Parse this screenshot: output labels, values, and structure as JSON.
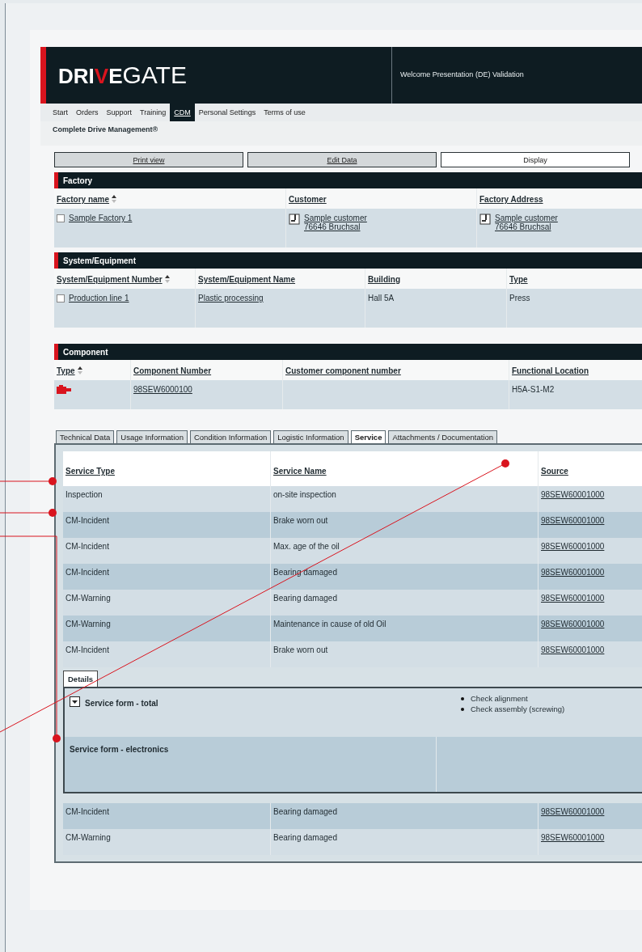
{
  "header": {
    "logo": {
      "lead": "DRI",
      "accent": "V",
      "tail": "E",
      "word": "GATE"
    },
    "welcome": "Welcome Presentation (DE) Validation"
  },
  "nav": [
    {
      "label": "Start",
      "selected": false
    },
    {
      "label": "Orders",
      "selected": false
    },
    {
      "label": "Support",
      "selected": false
    },
    {
      "label": "Training",
      "selected": false
    },
    {
      "label": "CDM",
      "selected": true
    },
    {
      "label": "Personal Settings",
      "selected": false
    },
    {
      "label": "Terms of use",
      "selected": false
    }
  ],
  "subtitle": "Complete Drive Management®",
  "actions": [
    {
      "label": "Print view",
      "selected": false
    },
    {
      "label": "Edit Data",
      "selected": false
    },
    {
      "label": "Display",
      "selected": true
    }
  ],
  "sections": [
    {
      "title": "Factory",
      "columns": [
        {
          "label": "Factory name",
          "sorted": true
        },
        {
          "label": "Customer",
          "sorted": false
        },
        {
          "label": "Factory Address",
          "sorted": false
        }
      ],
      "rows": [
        [
          {
            "kind": "checkbox-link",
            "checked": false,
            "lines": [
              "Sample Factory 1"
            ]
          },
          {
            "kind": "contact-link",
            "lines": [
              "Sample customer",
              "76646 Bruchsal"
            ]
          },
          {
            "kind": "contact-link",
            "lines": [
              "Sample customer",
              "76646 Bruchsal"
            ]
          }
        ]
      ]
    },
    {
      "title": "System/Equipment",
      "columns": [
        {
          "label": "System/Equipment Number",
          "sorted": true
        },
        {
          "label": "System/Equipment Name",
          "sorted": false
        },
        {
          "label": "Building",
          "sorted": false
        },
        {
          "label": "Type",
          "sorted": false
        }
      ],
      "rows": [
        [
          {
            "kind": "checkbox-link",
            "checked": false,
            "lines": [
              "Production line 1"
            ]
          },
          {
            "kind": "link",
            "lines": [
              "Plastic processing"
            ]
          },
          {
            "kind": "text",
            "lines": [
              "Hall 5A"
            ]
          },
          {
            "kind": "text",
            "lines": [
              "Press"
            ]
          }
        ]
      ]
    },
    {
      "title": "Component",
      "columns": [
        {
          "label": "Type",
          "sorted": true
        },
        {
          "label": "Component Number",
          "sorted": false
        },
        {
          "label": "Customer component number",
          "sorted": false
        },
        {
          "label": "Functional Location",
          "sorted": false
        }
      ],
      "rows": [
        [
          {
            "kind": "type-icon"
          },
          {
            "kind": "link",
            "lines": [
              "98SEW6000100"
            ]
          },
          {
            "kind": "text"
          },
          {
            "kind": "text",
            "lines": [
              "H5A-S1-M2"
            ]
          }
        ]
      ]
    }
  ],
  "tabs": [
    {
      "label": "Technical Data",
      "selected": false
    },
    {
      "label": "Usage Information",
      "selected": false
    },
    {
      "label": "Condition Information",
      "selected": false
    },
    {
      "label": "Logistic Information",
      "selected": false
    },
    {
      "label": "Service",
      "selected": true
    },
    {
      "label": "Attachments / Documentation",
      "selected": false
    }
  ],
  "service": {
    "columns": [
      "Service Type",
      "Service Name",
      "Source"
    ],
    "rows": [
      [
        "Inspection",
        "on-site inspection",
        "98SEW60001000"
      ],
      [
        "CM-Incident",
        "Brake worn out",
        "98SEW60001000"
      ],
      [
        "CM-Incident",
        "Max. age of the oil",
        "98SEW60001000"
      ],
      [
        "CM-Incident",
        "Bearing damaged",
        "98SEW60001000"
      ],
      [
        "CM-Warning",
        "Bearing damaged",
        "98SEW60001000"
      ],
      [
        "CM-Warning",
        "Maintenance in cause of old Oil",
        "98SEW60001000"
      ],
      [
        "CM-Incident",
        "Brake worn out",
        "98SEW60001000"
      ]
    ],
    "details": {
      "tab": "Details",
      "forms": [
        {
          "title": "Service form - total",
          "expandable": true,
          "bullets": [
            "Check alignment",
            "Check assembly (screwing)"
          ]
        },
        {
          "title": "Service form - electronics",
          "expandable": false
        }
      ]
    },
    "rows_after": [
      [
        "CM-Incident",
        "Bearing damaged",
        "98SEW60001000"
      ],
      [
        "CM-Warning",
        "Bearing damaged",
        "98SEW60001000"
      ]
    ]
  }
}
